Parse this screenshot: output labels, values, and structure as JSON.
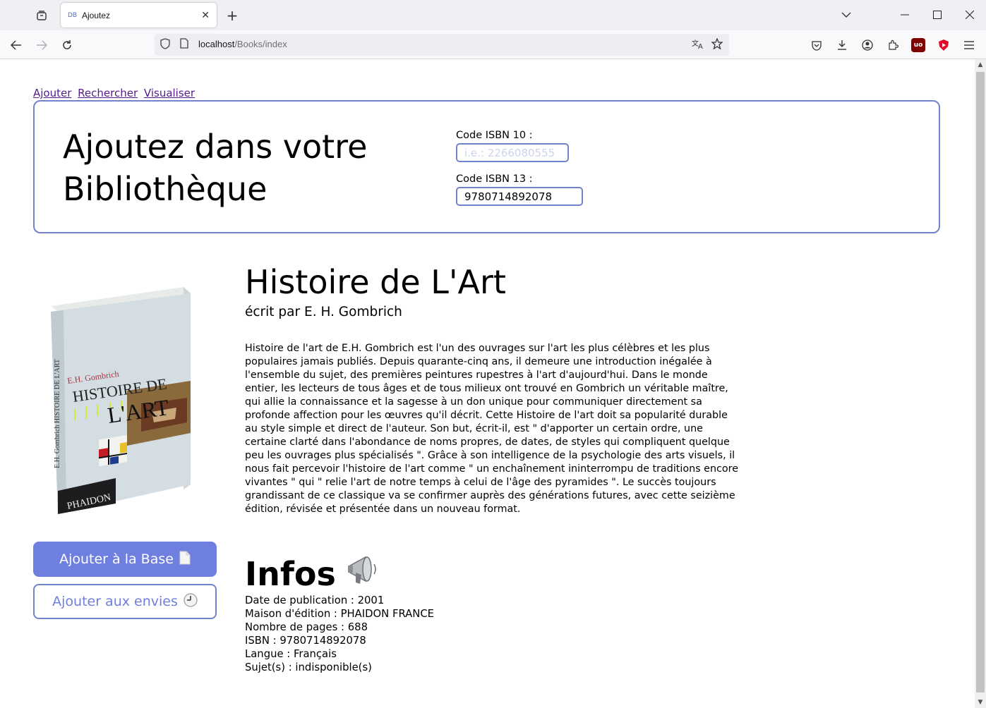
{
  "browser": {
    "tab": {
      "favicon_text": "DB",
      "title": "Ajoutez"
    },
    "url": {
      "host": "localhost",
      "path": "/Books/index"
    }
  },
  "nav_links": [
    "Ajouter",
    "Rechercher",
    "Visualiser"
  ],
  "add_form": {
    "heading": "Ajoutez dans votre Bibliothèque",
    "isbn10": {
      "label": "Code ISBN 10 :",
      "placeholder": "i.e.: 2266080555",
      "value": ""
    },
    "isbn13": {
      "label": "Code ISBN 13 :",
      "placeholder": "",
      "value": "9780714892078"
    }
  },
  "book": {
    "title": "Histoire de L'Art",
    "author_line": "écrit par E. H. Gombrich",
    "description": "Histoire de l'art de E.H. Gombrich est l'un des ouvrages sur l'art les plus célèbres et les plus populaires jamais publiés. Depuis quarante-cinq ans, il demeure une introduction inégalée à l'ensemble du sujet, des premières peintures rupestres à l'art d'aujourd'hui. Dans le monde entier, les lecteurs de tous âges et de tous milieux ont trouvé en Gombrich un véritable maître, qui allie la connaissance et la sagesse à un don unique pour communiquer directement sa profonde affection pour les œuvres qu'il décrit. Cette Histoire de l'art doit sa popularité durable au style simple et direct de l'auteur. Son but, écrit-il, est \" d'apporter un certain ordre, une certaine clarté dans l'abondance de noms propres, de dates, de styles qui compliquent quelque peu les ouvrages plus spécialisés \". Grâce à son intelligence de la psychologie des arts visuels, il nous fait percevoir l'histoire de l'art comme \" un enchaînement ininterrompu de traditions encore vivantes \" qui \" relie l'art de notre temps à celui de l'âge des pyramides \". Le succès toujours grandissant de ce classique va se confirmer auprès des générations futures, avec cette seizième édition, révisée et présentée dans un nouveau format.",
    "cover": {
      "author": "E.H. Gombrich",
      "title_line1": "HISTOIRE DE",
      "title_line2": "L'ART",
      "spine": "E.H. Gombrich  HISTOIRE DE L'ART",
      "publisher": "PHAIDON"
    }
  },
  "actions": {
    "add_to_base": {
      "label": "Ajouter à la Base",
      "icon": "📄"
    },
    "add_to_wishlist": {
      "label": "Ajouter aux envies",
      "icon": "🕘"
    }
  },
  "infos": {
    "heading": "Infos",
    "icon": "📢",
    "rows": [
      "Date de publication : 2001",
      "Maison d'édition : PHAIDON FRANCE",
      "Nombre de pages : 688",
      "ISBN : 9780714892078",
      "Langue : Français",
      "Sujet(s) : indisponible(s)"
    ]
  },
  "colors": {
    "accent": "#6f7fe0",
    "border": "#7383cb",
    "link": "#551a8b"
  }
}
